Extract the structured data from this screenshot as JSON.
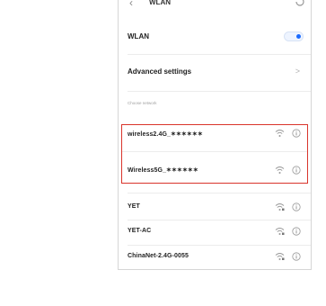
{
  "header": {
    "back_icon": "chevron-left-icon",
    "title": "WLAN",
    "refresh_icon": "refresh-icon"
  },
  "wlan_toggle": {
    "label": "WLAN",
    "state": "on",
    "accent": "#1a6bff"
  },
  "advanced": {
    "label": "Advanced settings",
    "chevron": ">"
  },
  "section": {
    "label": "Choose network"
  },
  "networks": [
    {
      "name": "wireless2.4G_✶✶✶✶✶✶",
      "signal_icon": "wifi-full-icon",
      "info_icon": "info-icon",
      "highlighted": true
    },
    {
      "name": "Wireless5G_✶✶✶✶✶✶",
      "signal_icon": "wifi-full-icon",
      "info_icon": "info-icon",
      "highlighted": true
    },
    {
      "name": "YET",
      "signal_icon": "wifi-locked-icon",
      "info_icon": "info-icon",
      "highlighted": false
    },
    {
      "name": "YET-AC",
      "signal_icon": "wifi-locked-icon",
      "info_icon": "info-icon",
      "highlighted": false
    },
    {
      "name": "ChinaNet-2.4G-0055",
      "signal_icon": "wifi-locked-icon",
      "info_icon": "info-icon",
      "highlighted": false
    }
  ],
  "colors": {
    "highlight": "#d9342b",
    "toggle_on": "#1a6bff"
  }
}
